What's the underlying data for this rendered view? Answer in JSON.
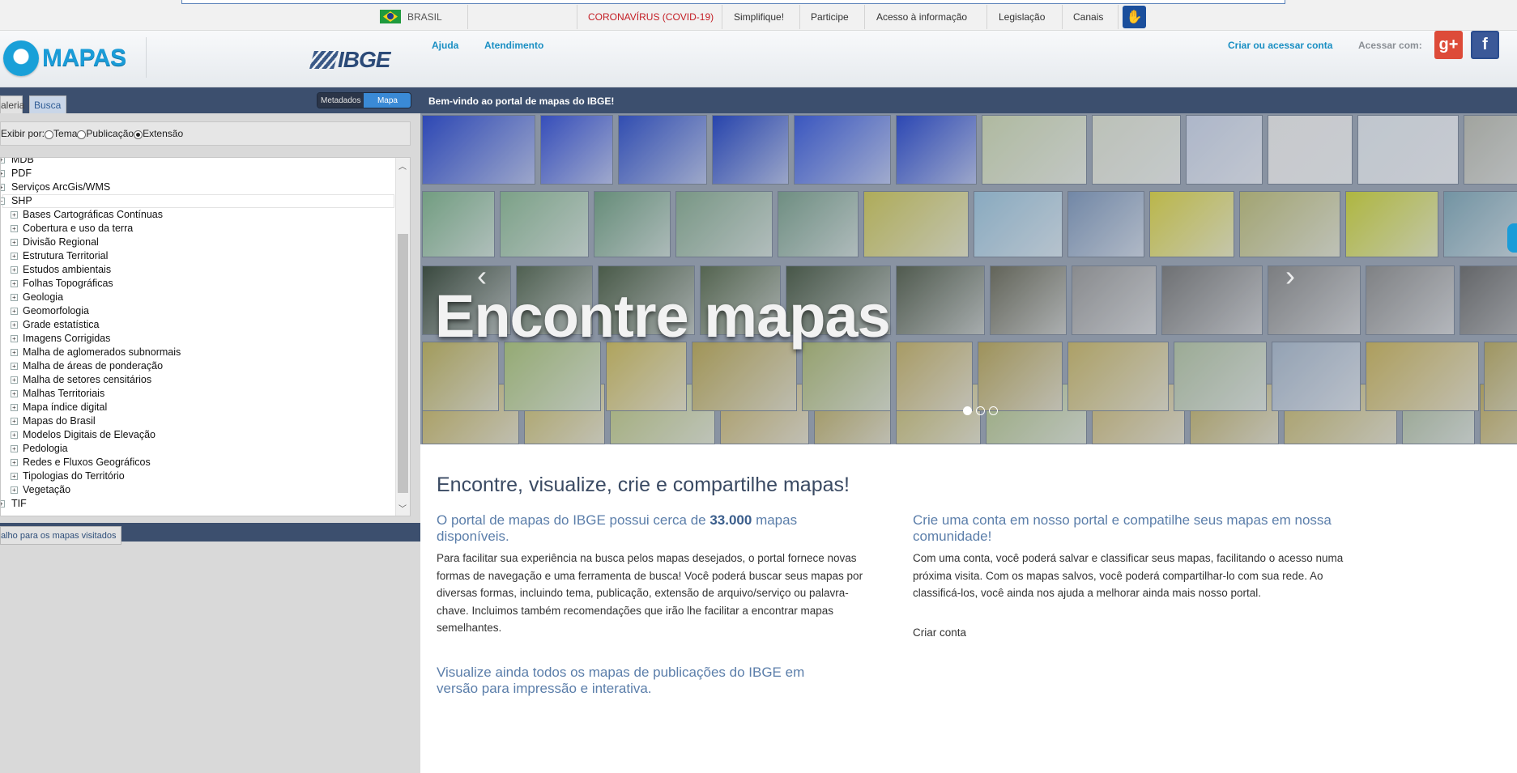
{
  "govbar": {
    "country": "BRASIL",
    "links": [
      "CORONAVÍRUS (COVID-19)",
      "Simplifique!",
      "Participe",
      "Acesso à informação",
      "Legislação",
      "Canais"
    ]
  },
  "header": {
    "logo_text": "MAPAS",
    "ibge_text": "IBGE",
    "help": "Ajuda",
    "support": "Atendimento",
    "create_account": "Criar ou acessar conta",
    "access_with": "Acessar com:",
    "google_label": "g+",
    "facebook_label": "f"
  },
  "left": {
    "tabs": [
      "aleria",
      "Busca"
    ],
    "toggle": [
      "Metadados",
      "Mapa"
    ],
    "filter_prefix": "Exibir por:",
    "filter_options": [
      "Tema",
      "Publicação",
      "Extensão"
    ],
    "filter_selected": "Extensão",
    "tree_top": [
      "MDB",
      "PDF",
      "Serviços ArcGis/WMS",
      "SHP"
    ],
    "tree_children": [
      "Bases Cartográficas Contínuas",
      "Cobertura e uso da terra",
      "Divisão Regional",
      "Estrutura Territorial",
      "Estudos ambientais",
      "Folhas Topográficas",
      "Geologia",
      "Geomorfologia",
      "Grade estatística",
      "Imagens Corrigidas",
      "Malha de aglomerados subnormais",
      "Malha de áreas de ponderação",
      "Malha de setores censitários",
      "Malhas Territoriais",
      "Mapa índice digital",
      "Mapas do Brasil",
      "Modelos Digitais de Elevação",
      "Pedologia",
      "Redes e Fluxos Geográficos",
      "Tipologias do Território",
      "Vegetação"
    ],
    "tree_bottom": "TIF",
    "visited_tab": "alho para os mapas visitados"
  },
  "main": {
    "welcome": "Bem-vindo ao portal de mapas do IBGE!",
    "slogan": "Encontre mapas",
    "headline": "Encontre, visualize, crie e compartilhe mapas!",
    "col1": {
      "subhead_pre": "O portal de mapas do IBGE possui cerca de ",
      "subhead_bold": "33.000",
      "subhead_post": " mapas disponíveis.",
      "paragraph": "Para facilitar sua experiência na busca pelos mapas desejados, o portal fornece novas formas de navegação e uma ferramenta de busca! Você poderá buscar seus mapas por diversas formas, incluindo tema, publicação, extensão de arquivo/serviço ou palavra-chave. Incluimos também recomendações que irão lhe facilitar a encontrar mapas semelhantes.",
      "subhead2": "Visualize ainda todos os mapas de publicações do IBGE em versão para impressão e interativa."
    },
    "col2": {
      "subhead": "Crie uma conta em nosso portal e compatilhe seus mapas em nossa comunidade!",
      "paragraph": "Com uma conta, você poderá salvar e classificar seus mapas, facilitando o acesso numa próxima visita. Com os mapas salvos, você poderá compartilhar-lo com sua rede. Ao classificá-los, você ainda nos ajuda a melhorar ainda mais nosso portal.",
      "link": "Criar conta"
    },
    "carousel_active_index": 0,
    "carousel_count": 3
  },
  "colors": {
    "nav_dark": "#3c4f6e",
    "accent_blue": "#1a9cd8",
    "covid_red": "#c41e25",
    "heading_blue": "#5b7eaa"
  }
}
